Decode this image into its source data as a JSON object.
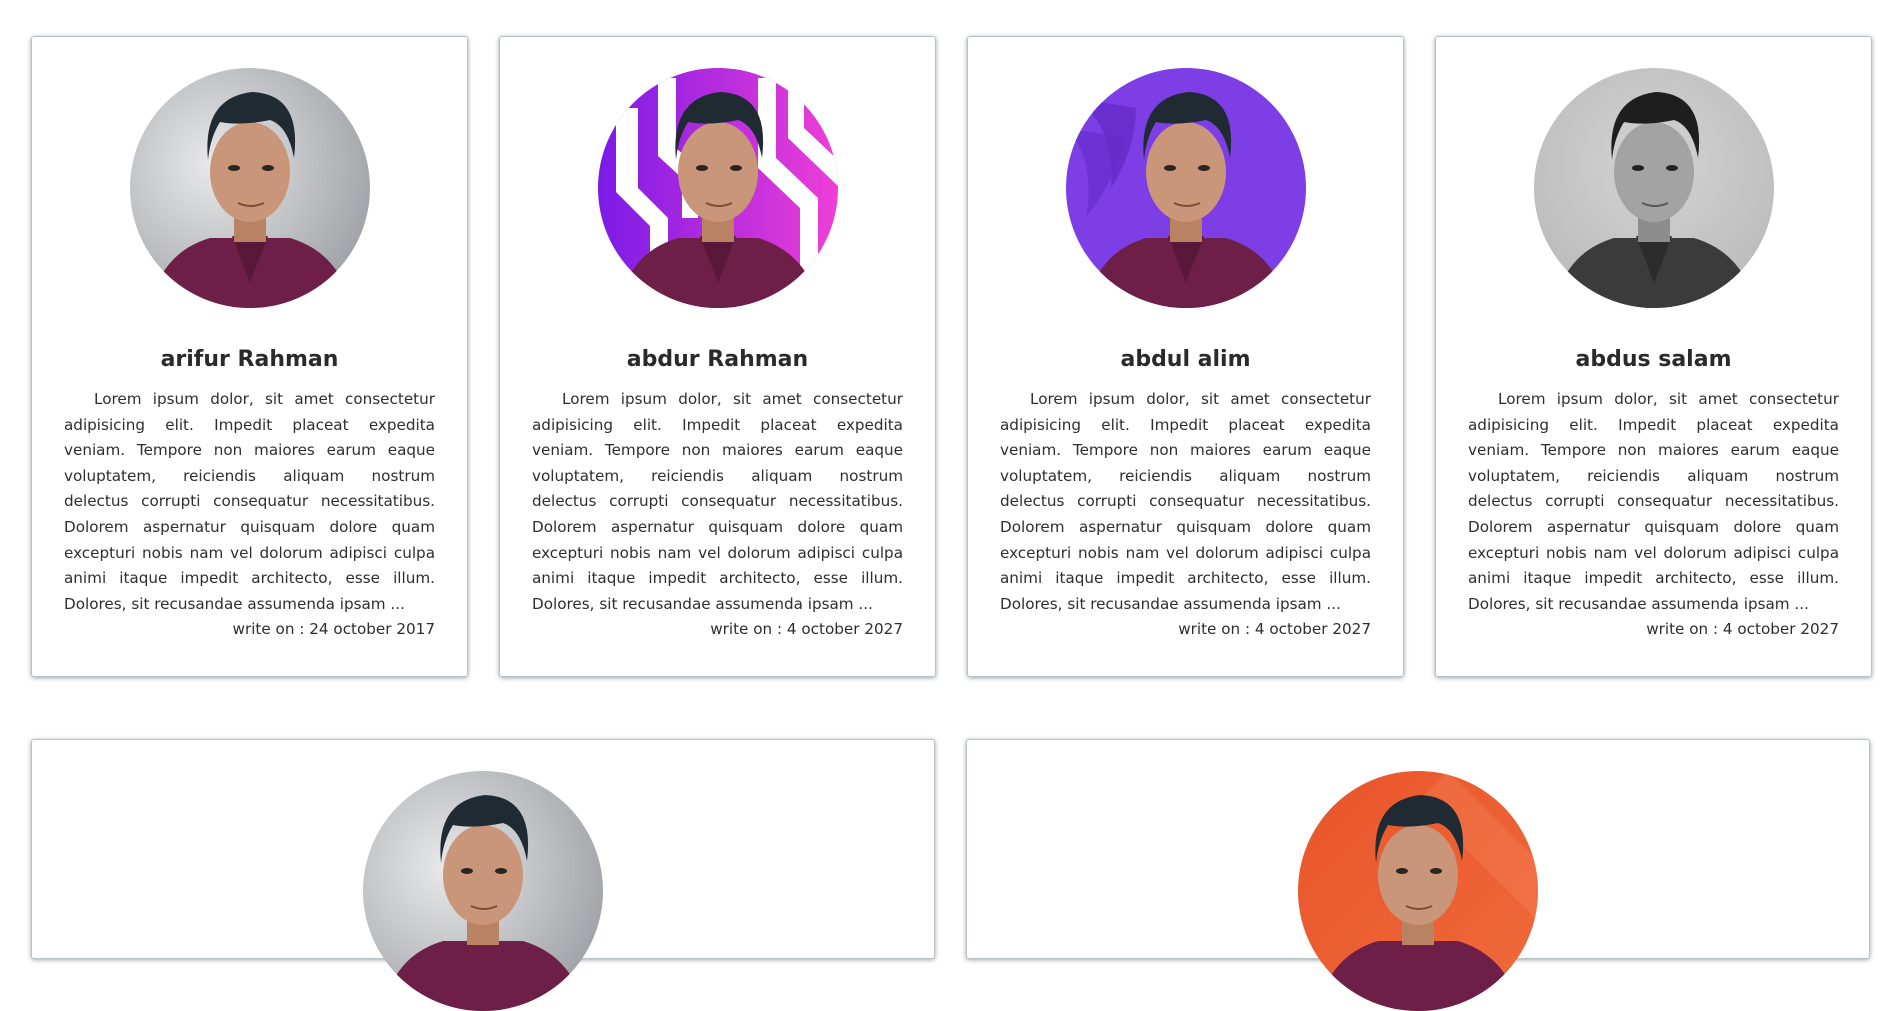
{
  "cards": [
    {
      "name": "arifur Rahman",
      "description": "Lorem ipsum dolor, sit amet consectetur adipisicing elit. Impedit placeat expedita veniam. Tempore non maiores earum eaque voluptatem, reiciendis aliquam nostrum delectus corrupti consequatur necessitatibus. Dolorem aspernatur quisquam dolore quam excepturi nobis nam vel dolorum adipisci culpa animi itaque impedit architecto, esse illum. Dolores, sit recusandae assumenda ipsam ...",
      "date": "write on : 24 october 2017",
      "photo_background": "gray studio"
    },
    {
      "name": "abdur Rahman",
      "description": "Lorem ipsum dolor, sit amet consectetur adipisicing elit. Impedit placeat expedita veniam. Tempore non maiores earum eaque voluptatem, reiciendis aliquam nostrum delectus corrupti consequatur necessitatibus. Dolorem aspernatur quisquam dolore quam excepturi nobis nam vel dolorum adipisci culpa animi itaque impedit architecto, esse illum. Dolores, sit recusandae assumenda ipsam ...",
      "date": "write on : 4 october 2027",
      "photo_background": "purple-pink stripes"
    },
    {
      "name": "abdul alim",
      "description": "Lorem ipsum dolor, sit amet consectetur adipisicing elit. Impedit placeat expedita veniam. Tempore non maiores earum eaque voluptatem, reiciendis aliquam nostrum delectus corrupti consequatur necessitatibus. Dolorem aspernatur quisquam dolore quam excepturi nobis nam vel dolorum adipisci culpa animi itaque impedit architecto, esse illum. Dolores, sit recusandae assumenda ipsam ...",
      "date": "write on : 4 october 2027",
      "photo_background": "violet"
    },
    {
      "name": "abdus salam",
      "description": "Lorem ipsum dolor, sit amet consectetur adipisicing elit. Impedit placeat expedita veniam. Tempore non maiores earum eaque voluptatem, reiciendis aliquam nostrum delectus corrupti consequatur necessitatibus. Dolorem aspernatur quisquam dolore quam excepturi nobis nam vel dolorum adipisci culpa animi itaque impedit architecto, esse illum. Dolores, sit recusandae assumenda ipsam ...",
      "date": "write on : 4 october 2027",
      "photo_background": "grayscale"
    }
  ],
  "wide_cards": [
    {
      "photo_background": "gray studio"
    },
    {
      "photo_background": "orange"
    }
  ],
  "colors": {
    "card_border": "#b9c0c6",
    "text": "#2e2e2e",
    "shirt": "#6e1f48",
    "hair": "#1f2a33",
    "skin": "#c99679"
  }
}
